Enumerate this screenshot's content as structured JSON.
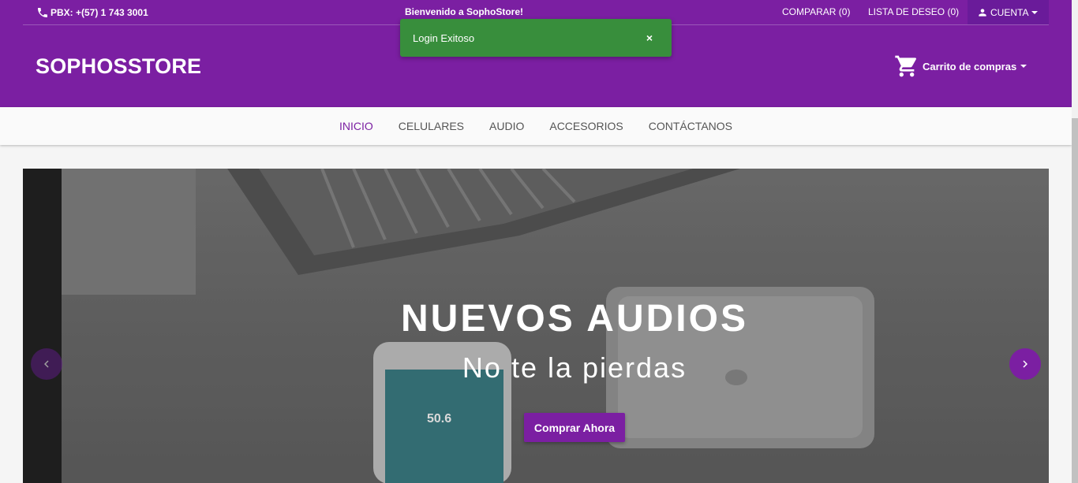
{
  "topbar": {
    "phone": "PBX: +(57) 1 743 3001",
    "welcome": "Bienvenido a SophoStore!",
    "compare": "COMPARAR (0)",
    "wishlist": "LISTA DE DESEO (0)",
    "account": "CUENTA"
  },
  "header": {
    "brand": "SOPHOSSTORE",
    "cart": "Carrito de compras"
  },
  "toast": {
    "message": "Login Exitoso",
    "close": "×"
  },
  "nav": {
    "items": [
      {
        "label": "INICIO",
        "active": true
      },
      {
        "label": "CELULARES",
        "active": false
      },
      {
        "label": "AUDIO",
        "active": false
      },
      {
        "label": "ACCESORIOS",
        "active": false
      },
      {
        "label": "CONTÁCTANOS",
        "active": false
      }
    ]
  },
  "slider": {
    "title": "NUEVOS AUDIOS",
    "subtitle": "No te la pierdas",
    "button": "Comprar Ahora"
  },
  "colors": {
    "brand": "#7b1fa2",
    "success": "#388e3c"
  }
}
